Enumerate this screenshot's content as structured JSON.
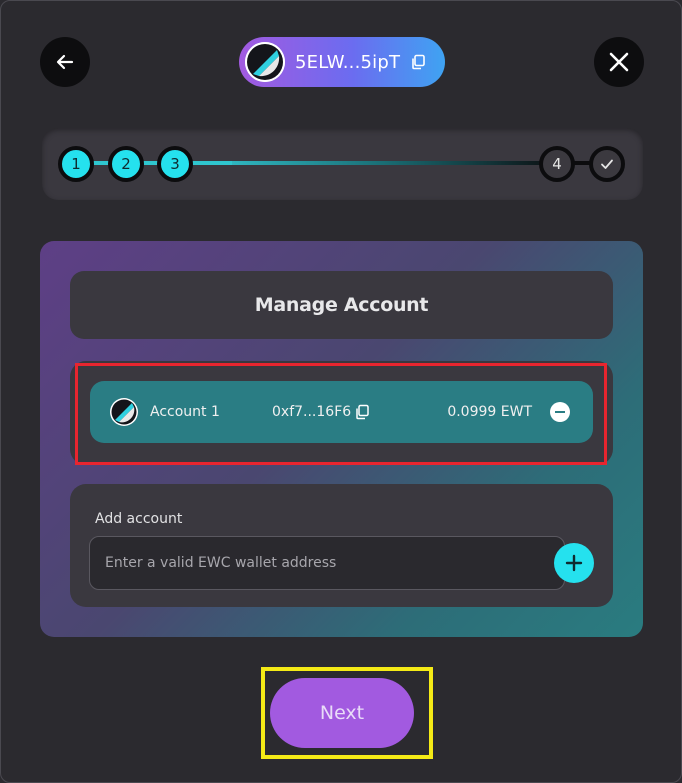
{
  "header": {
    "back_icon": "arrow-left-icon",
    "close_icon": "close-icon",
    "account_pill": {
      "label": "5ELW...5ipT",
      "copy_icon": "copy-icon"
    }
  },
  "stepper": {
    "steps": [
      {
        "label": "1",
        "state": "done"
      },
      {
        "label": "2",
        "state": "done"
      },
      {
        "label": "3",
        "state": "current"
      },
      {
        "label": "4",
        "state": "pending"
      },
      {
        "label": "",
        "state": "pending",
        "icon": "check-icon"
      }
    ]
  },
  "panel": {
    "title": "Manage Account",
    "accounts": [
      {
        "name": "Account 1",
        "address": "0xf7...16F6",
        "balance": "0.0999 EWT"
      }
    ],
    "add_account": {
      "label": "Add account",
      "placeholder": "Enter a valid EWC wallet address",
      "value": ""
    }
  },
  "next_button": {
    "label": "Next"
  },
  "colors": {
    "accent_cyan": "#25e1ee",
    "accent_purple": "#a25ae0",
    "account_row": "#2a7d84",
    "highlight_red": "#e8252f",
    "highlight_yellow": "#f4ea16"
  }
}
